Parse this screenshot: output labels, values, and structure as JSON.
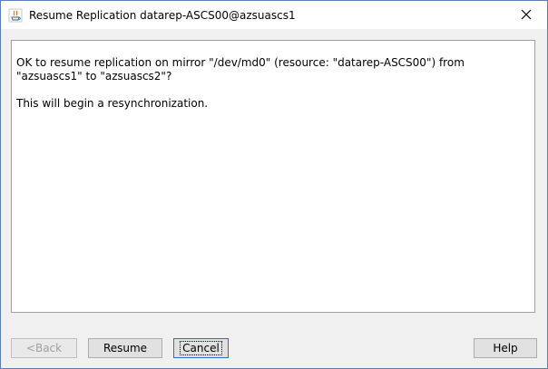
{
  "window": {
    "title": "Resume Replication datarep-ASCS00@azsuascs1",
    "close_symbol": "✕"
  },
  "message": {
    "line1": "OK to resume replication on mirror \"/dev/md0\" (resource: \"datarep-ASCS00\") from",
    "line2": "\"azsuascs1\" to \"azsuascs2\"?",
    "line3": "This will begin a resynchronization."
  },
  "buttons": {
    "back": "<Back",
    "resume": "Resume",
    "cancel": "Cancel",
    "help": "Help"
  },
  "icons": {
    "title_icon": "java-app-icon",
    "close_icon": "close-icon"
  }
}
